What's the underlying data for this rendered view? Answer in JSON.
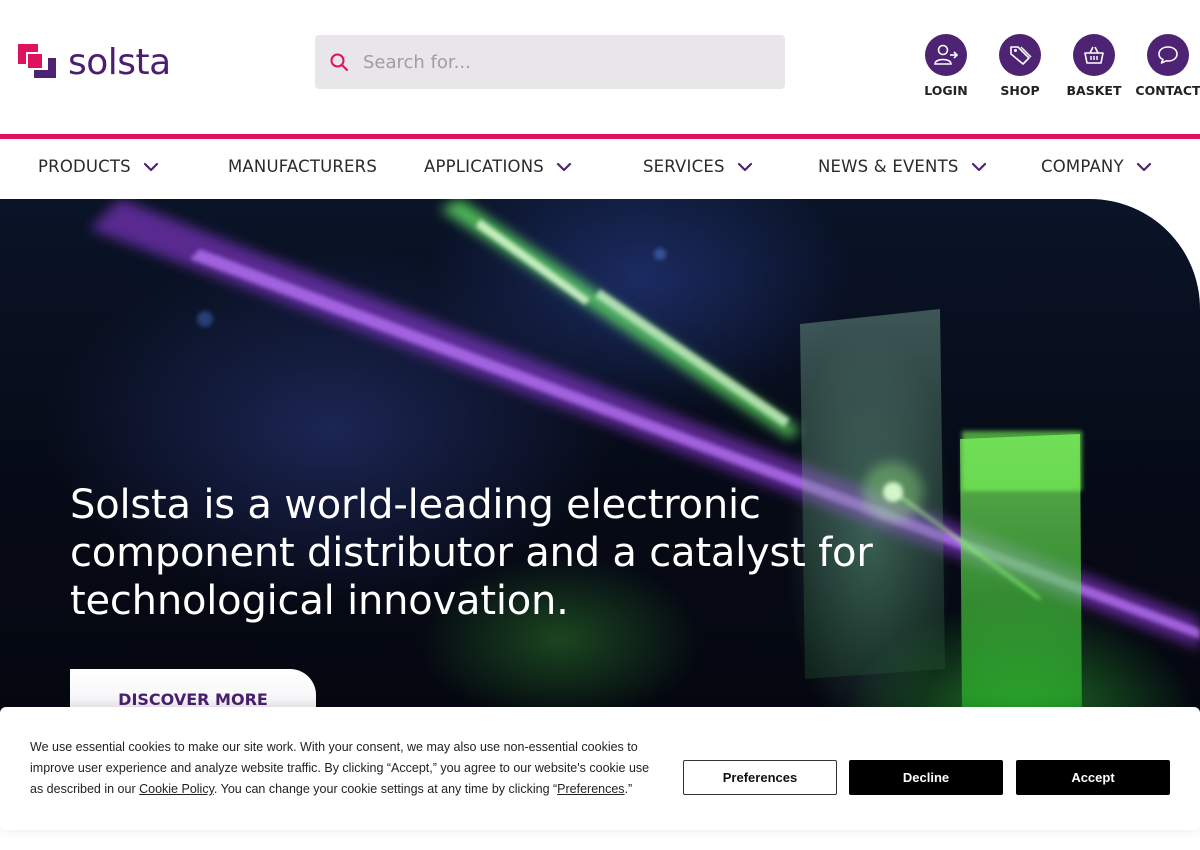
{
  "brand": {
    "name": "solsta",
    "primary": "#4e2374",
    "accent": "#e0125e"
  },
  "search": {
    "placeholder": "Search for...",
    "icon": "search-icon"
  },
  "utility": [
    {
      "label": "LOGIN",
      "icon": "user-login-icon"
    },
    {
      "label": "SHOP",
      "icon": "tag-icon"
    },
    {
      "label": "BASKET",
      "icon": "basket-icon"
    },
    {
      "label": "CONTACT",
      "icon": "chat-bubble-icon"
    }
  ],
  "nav": [
    {
      "label": "PRODUCTS",
      "dropdown": true
    },
    {
      "label": "MANUFACTURERS",
      "dropdown": false
    },
    {
      "label": "APPLICATIONS",
      "dropdown": true
    },
    {
      "label": "SERVICES",
      "dropdown": true
    },
    {
      "label": "NEWS & EVENTS",
      "dropdown": true
    },
    {
      "label": "COMPANY",
      "dropdown": true
    }
  ],
  "hero": {
    "title": "Solsta is a world-leading electronic component distributor and a catalyst for technological innovation.",
    "cta": "DISCOVER MORE"
  },
  "cookie": {
    "text_part1": "We use essential cookies to make our site work. With your consent, we may also use non-essential cookies to improve user experience and analyze website traffic. By clicking “Accept,” you agree to our website's cookie use as described in our ",
    "policy_link": "Cookie Policy",
    "text_part2": ". You can change your cookie settings at any time by clicking “",
    "preferences_link": "Preferences",
    "text_part3": ".”",
    "buttons": {
      "preferences": "Preferences",
      "decline": "Decline",
      "accept": "Accept"
    }
  }
}
